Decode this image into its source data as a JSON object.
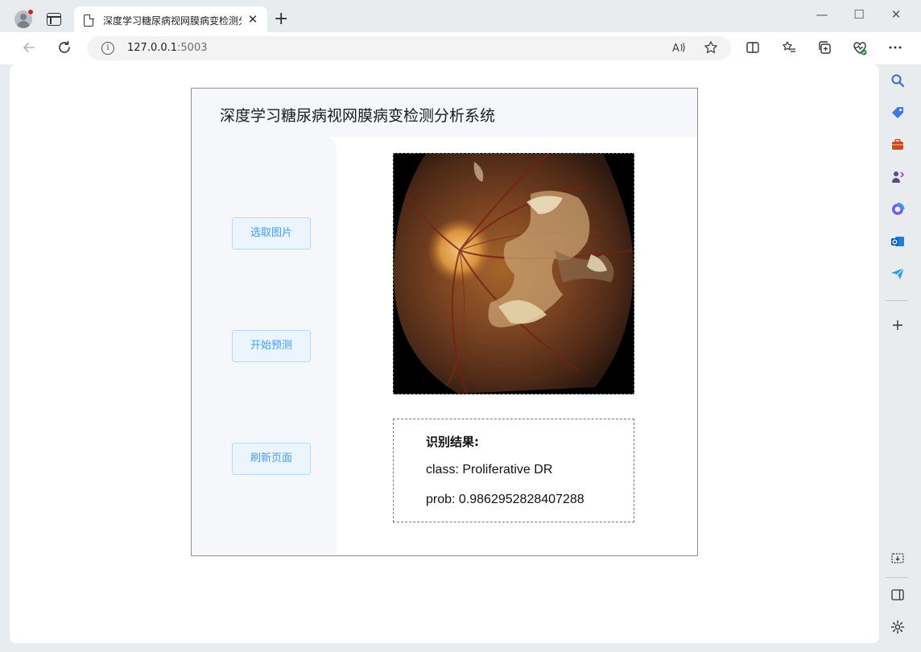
{
  "browser": {
    "tab_title": "深度学习糖尿病视网膜病变检测分析系统",
    "tab_close": "✕",
    "new_tab": "+",
    "url_host": "127.0.0.1",
    "url_port": ":5003",
    "window_controls": {
      "minimize": "—",
      "maximize": "☐",
      "close": "✕"
    }
  },
  "app": {
    "title": "深度学习糖尿病视网膜病变检测分析系统",
    "buttons": {
      "select_image": "选取图片",
      "start_predict": "开始预测",
      "refresh_page": "刷新页面"
    },
    "result": {
      "heading": "识别结果:",
      "class_line": "class: Proliferative DR",
      "prob_line": "prob: 0.9862952828407288"
    }
  },
  "colors": {
    "button_text": "#409eff",
    "button_bg": "#ecf5ff",
    "button_border": "#b3d8ff",
    "panel_bg": "#f5f7fa"
  },
  "icons": {
    "back": "arrow-left-icon",
    "reload": "reload-icon",
    "info": "info-icon",
    "read_aloud": "read-aloud-icon",
    "favorite": "star-icon",
    "split_screen": "split-screen-icon",
    "favorites": "favorites-list-icon",
    "collections": "collections-icon",
    "performance": "heart-pulse-icon",
    "more": "more-icon"
  }
}
